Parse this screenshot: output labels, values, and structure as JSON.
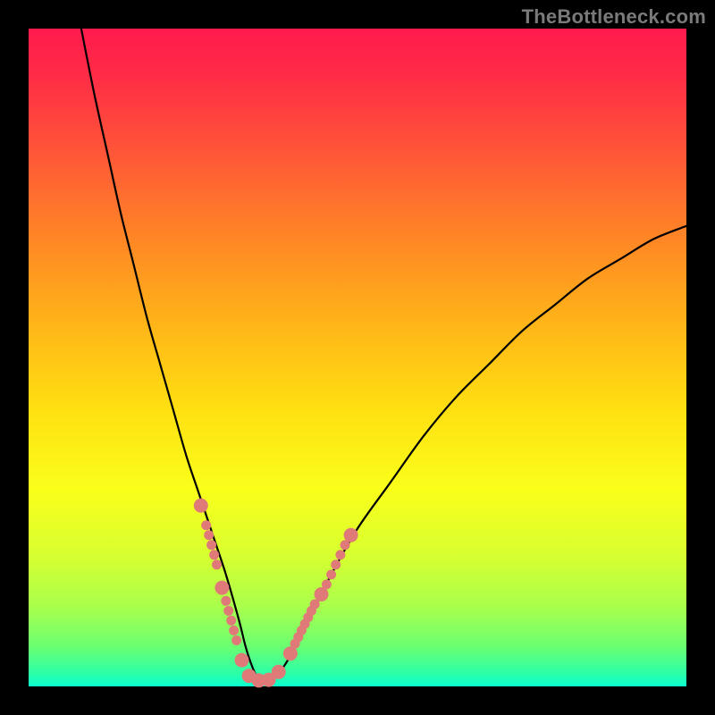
{
  "watermark": "TheBottleneck.com",
  "chart_data": {
    "type": "line",
    "title": "",
    "xlabel": "",
    "ylabel": "",
    "xlim": [
      0,
      100
    ],
    "ylim": [
      0,
      100
    ],
    "series": [
      {
        "name": "bottleneck-curve",
        "x": [
          8,
          10,
          12,
          14,
          16,
          18,
          20,
          22,
          24,
          26,
          28,
          30,
          32,
          33,
          34,
          35,
          36,
          38,
          40,
          42,
          44,
          46,
          50,
          55,
          60,
          65,
          70,
          75,
          80,
          85,
          90,
          95,
          100
        ],
        "values": [
          100,
          90,
          81,
          72,
          64,
          56,
          49,
          42,
          35,
          29,
          23,
          17,
          10,
          6,
          3,
          1,
          1,
          2,
          5,
          9,
          13,
          17,
          24,
          31,
          38,
          44,
          49,
          54,
          58,
          62,
          65,
          68,
          70
        ]
      }
    ],
    "markers": {
      "name": "salmon-dots",
      "color": "#e07a78",
      "radius_large": 8,
      "radius_small": 5.5,
      "points": [
        {
          "x": 26.2,
          "y": 27.5,
          "r": "large"
        },
        {
          "x": 27.0,
          "y": 24.5,
          "r": "small"
        },
        {
          "x": 27.4,
          "y": 23.0,
          "r": "small"
        },
        {
          "x": 27.8,
          "y": 21.5,
          "r": "small"
        },
        {
          "x": 28.2,
          "y": 20.0,
          "r": "small"
        },
        {
          "x": 28.6,
          "y": 18.5,
          "r": "small"
        },
        {
          "x": 29.4,
          "y": 15.0,
          "r": "large"
        },
        {
          "x": 30.0,
          "y": 13.0,
          "r": "small"
        },
        {
          "x": 30.4,
          "y": 11.5,
          "r": "small"
        },
        {
          "x": 30.8,
          "y": 10.0,
          "r": "small"
        },
        {
          "x": 31.2,
          "y": 8.5,
          "r": "small"
        },
        {
          "x": 31.6,
          "y": 7.0,
          "r": "small"
        },
        {
          "x": 32.4,
          "y": 4.0,
          "r": "large"
        },
        {
          "x": 33.5,
          "y": 1.6,
          "r": "large"
        },
        {
          "x": 35.0,
          "y": 0.9,
          "r": "large"
        },
        {
          "x": 36.5,
          "y": 1.0,
          "r": "large"
        },
        {
          "x": 38.0,
          "y": 2.2,
          "r": "large"
        },
        {
          "x": 39.8,
          "y": 5.0,
          "r": "large"
        },
        {
          "x": 40.5,
          "y": 6.5,
          "r": "small"
        },
        {
          "x": 41.0,
          "y": 7.5,
          "r": "small"
        },
        {
          "x": 41.5,
          "y": 8.5,
          "r": "small"
        },
        {
          "x": 42.0,
          "y": 9.5,
          "r": "small"
        },
        {
          "x": 42.5,
          "y": 10.5,
          "r": "small"
        },
        {
          "x": 43.0,
          "y": 11.5,
          "r": "small"
        },
        {
          "x": 43.5,
          "y": 12.5,
          "r": "small"
        },
        {
          "x": 44.5,
          "y": 14.0,
          "r": "large"
        },
        {
          "x": 45.3,
          "y": 15.5,
          "r": "small"
        },
        {
          "x": 46.0,
          "y": 17.0,
          "r": "small"
        },
        {
          "x": 46.7,
          "y": 18.5,
          "r": "small"
        },
        {
          "x": 47.4,
          "y": 20.0,
          "r": "small"
        },
        {
          "x": 48.1,
          "y": 21.5,
          "r": "small"
        },
        {
          "x": 49.0,
          "y": 23.0,
          "r": "large"
        }
      ]
    }
  }
}
